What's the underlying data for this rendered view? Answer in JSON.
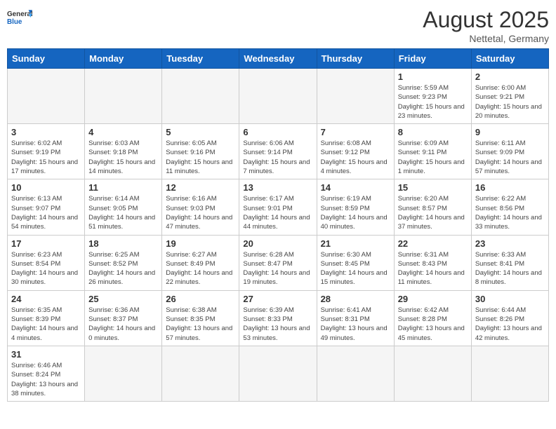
{
  "header": {
    "logo_general": "General",
    "logo_blue": "Blue",
    "month_title": "August 2025",
    "location": "Nettetal, Germany"
  },
  "weekdays": [
    "Sunday",
    "Monday",
    "Tuesday",
    "Wednesday",
    "Thursday",
    "Friday",
    "Saturday"
  ],
  "weeks": [
    [
      {
        "day": "",
        "info": ""
      },
      {
        "day": "",
        "info": ""
      },
      {
        "day": "",
        "info": ""
      },
      {
        "day": "",
        "info": ""
      },
      {
        "day": "",
        "info": ""
      },
      {
        "day": "1",
        "info": "Sunrise: 5:59 AM\nSunset: 9:23 PM\nDaylight: 15 hours and 23 minutes."
      },
      {
        "day": "2",
        "info": "Sunrise: 6:00 AM\nSunset: 9:21 PM\nDaylight: 15 hours and 20 minutes."
      }
    ],
    [
      {
        "day": "3",
        "info": "Sunrise: 6:02 AM\nSunset: 9:19 PM\nDaylight: 15 hours and 17 minutes."
      },
      {
        "day": "4",
        "info": "Sunrise: 6:03 AM\nSunset: 9:18 PM\nDaylight: 15 hours and 14 minutes."
      },
      {
        "day": "5",
        "info": "Sunrise: 6:05 AM\nSunset: 9:16 PM\nDaylight: 15 hours and 11 minutes."
      },
      {
        "day": "6",
        "info": "Sunrise: 6:06 AM\nSunset: 9:14 PM\nDaylight: 15 hours and 7 minutes."
      },
      {
        "day": "7",
        "info": "Sunrise: 6:08 AM\nSunset: 9:12 PM\nDaylight: 15 hours and 4 minutes."
      },
      {
        "day": "8",
        "info": "Sunrise: 6:09 AM\nSunset: 9:11 PM\nDaylight: 15 hours and 1 minute."
      },
      {
        "day": "9",
        "info": "Sunrise: 6:11 AM\nSunset: 9:09 PM\nDaylight: 14 hours and 57 minutes."
      }
    ],
    [
      {
        "day": "10",
        "info": "Sunrise: 6:13 AM\nSunset: 9:07 PM\nDaylight: 14 hours and 54 minutes."
      },
      {
        "day": "11",
        "info": "Sunrise: 6:14 AM\nSunset: 9:05 PM\nDaylight: 14 hours and 51 minutes."
      },
      {
        "day": "12",
        "info": "Sunrise: 6:16 AM\nSunset: 9:03 PM\nDaylight: 14 hours and 47 minutes."
      },
      {
        "day": "13",
        "info": "Sunrise: 6:17 AM\nSunset: 9:01 PM\nDaylight: 14 hours and 44 minutes."
      },
      {
        "day": "14",
        "info": "Sunrise: 6:19 AM\nSunset: 8:59 PM\nDaylight: 14 hours and 40 minutes."
      },
      {
        "day": "15",
        "info": "Sunrise: 6:20 AM\nSunset: 8:57 PM\nDaylight: 14 hours and 37 minutes."
      },
      {
        "day": "16",
        "info": "Sunrise: 6:22 AM\nSunset: 8:56 PM\nDaylight: 14 hours and 33 minutes."
      }
    ],
    [
      {
        "day": "17",
        "info": "Sunrise: 6:23 AM\nSunset: 8:54 PM\nDaylight: 14 hours and 30 minutes."
      },
      {
        "day": "18",
        "info": "Sunrise: 6:25 AM\nSunset: 8:52 PM\nDaylight: 14 hours and 26 minutes."
      },
      {
        "day": "19",
        "info": "Sunrise: 6:27 AM\nSunset: 8:49 PM\nDaylight: 14 hours and 22 minutes."
      },
      {
        "day": "20",
        "info": "Sunrise: 6:28 AM\nSunset: 8:47 PM\nDaylight: 14 hours and 19 minutes."
      },
      {
        "day": "21",
        "info": "Sunrise: 6:30 AM\nSunset: 8:45 PM\nDaylight: 14 hours and 15 minutes."
      },
      {
        "day": "22",
        "info": "Sunrise: 6:31 AM\nSunset: 8:43 PM\nDaylight: 14 hours and 11 minutes."
      },
      {
        "day": "23",
        "info": "Sunrise: 6:33 AM\nSunset: 8:41 PM\nDaylight: 14 hours and 8 minutes."
      }
    ],
    [
      {
        "day": "24",
        "info": "Sunrise: 6:35 AM\nSunset: 8:39 PM\nDaylight: 14 hours and 4 minutes."
      },
      {
        "day": "25",
        "info": "Sunrise: 6:36 AM\nSunset: 8:37 PM\nDaylight: 14 hours and 0 minutes."
      },
      {
        "day": "26",
        "info": "Sunrise: 6:38 AM\nSunset: 8:35 PM\nDaylight: 13 hours and 57 minutes."
      },
      {
        "day": "27",
        "info": "Sunrise: 6:39 AM\nSunset: 8:33 PM\nDaylight: 13 hours and 53 minutes."
      },
      {
        "day": "28",
        "info": "Sunrise: 6:41 AM\nSunset: 8:31 PM\nDaylight: 13 hours and 49 minutes."
      },
      {
        "day": "29",
        "info": "Sunrise: 6:42 AM\nSunset: 8:28 PM\nDaylight: 13 hours and 45 minutes."
      },
      {
        "day": "30",
        "info": "Sunrise: 6:44 AM\nSunset: 8:26 PM\nDaylight: 13 hours and 42 minutes."
      }
    ],
    [
      {
        "day": "31",
        "info": "Sunrise: 6:46 AM\nSunset: 8:24 PM\nDaylight: 13 hours and 38 minutes."
      },
      {
        "day": "",
        "info": ""
      },
      {
        "day": "",
        "info": ""
      },
      {
        "day": "",
        "info": ""
      },
      {
        "day": "",
        "info": ""
      },
      {
        "day": "",
        "info": ""
      },
      {
        "day": "",
        "info": ""
      }
    ]
  ]
}
